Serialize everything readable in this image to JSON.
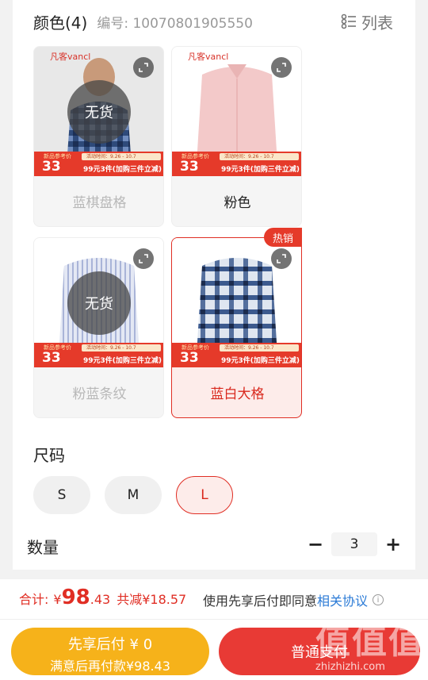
{
  "header": {
    "title": "颜色(4)",
    "code": "编号: 10070801905550",
    "list_label": "列表"
  },
  "colors": [
    {
      "name": "蓝棋盘格",
      "soldout": "无货",
      "brand": "凡客vancl",
      "price_tag": "新品参考价",
      "price": "33",
      "promo": "99元3件(加购三件立减)",
      "ribbon": "活动时间：9.26 - 10.7"
    },
    {
      "name": "粉色",
      "brand": "凡客vancl",
      "price_tag": "新品参考价",
      "price": "33",
      "promo": "99元3件(加购三件立减)",
      "ribbon": "活动时间：9.26 - 10.7"
    },
    {
      "name": "粉蓝条纹",
      "soldout": "无货",
      "price_tag": "新品参考价",
      "price": "33",
      "promo": "99元3件(加购三件立减)",
      "ribbon": "活动时间：9.26 - 10.7"
    },
    {
      "name": "蓝白大格",
      "hot": "热销",
      "price_tag": "新品参考价",
      "price": "33",
      "promo": "99元3件(加购三件立减)",
      "ribbon": "活动时间：9.26 - 10.7"
    }
  ],
  "size": {
    "title": "尺码",
    "options": [
      "S",
      "M",
      "L"
    ],
    "selected": "L"
  },
  "quantity": {
    "title": "数量",
    "minus": "−",
    "value": "3",
    "plus": "+"
  },
  "summary": {
    "total_label": "合计:",
    "currency": "¥",
    "amount_int": "98",
    "amount_dec": ".43",
    "savings": "共减¥18.57",
    "agree_text": "使用先享后付即同意",
    "agree_link": "相关协议",
    "info": "i"
  },
  "buttons": {
    "left_line1": "先享后付 ¥ 0",
    "left_line2": "满意后再付款¥98.43",
    "right": "普通支付"
  },
  "watermark": {
    "big": "值值值",
    "small": "zhizhizhi.com"
  },
  "colors_theme": {
    "accent": "#e02e24",
    "gold": "#f6b21a",
    "link": "#2a7ad6"
  }
}
